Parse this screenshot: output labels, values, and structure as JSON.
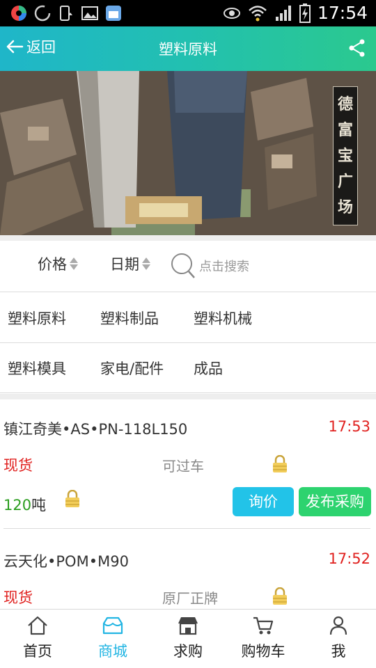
{
  "status_bar": {
    "time": "17:54",
    "icons": [
      "app-icon",
      "loading-icon",
      "phone-sync-icon",
      "image-icon",
      "store-icon",
      "eye-icon",
      "wifi-icon",
      "signal-icon",
      "battery-icon"
    ]
  },
  "header": {
    "back_label": "返回",
    "title": "塑料原料",
    "share_icon": "share-icon"
  },
  "banner": {
    "sign_chars": [
      "德",
      "富",
      "宝",
      "广",
      "场"
    ]
  },
  "sort_bar": {
    "price_label": "价格",
    "date_label": "日期",
    "search_placeholder": "点击搜索"
  },
  "categories": [
    [
      "塑料原料",
      "塑料制品",
      "塑料机械"
    ],
    [
      "塑料模具",
      "家电/配件",
      "成品"
    ]
  ],
  "listings": [
    {
      "name": "镇江奇美•AS•PN-118L150",
      "time": "17:53",
      "stock": "现货",
      "tag": "可过车",
      "quantity": "120",
      "unit": "吨",
      "inquire_label": "询价",
      "publish_label": "发布采购"
    },
    {
      "name": "云天化•POM•M90",
      "time": "17:52",
      "stock": "现货",
      "tag": "原厂正牌"
    }
  ],
  "bottom_nav": [
    {
      "label": "首页",
      "icon": "home-icon",
      "active": false
    },
    {
      "label": "商城",
      "icon": "mall-icon",
      "active": true
    },
    {
      "label": "求购",
      "icon": "shop-icon",
      "active": false
    },
    {
      "label": "购物车",
      "icon": "cart-icon",
      "active": false
    },
    {
      "label": "我",
      "icon": "user-icon",
      "active": false
    }
  ],
  "colors": {
    "header_start": "#1fb6c9",
    "header_end": "#2bc98e",
    "accent_red": "#e0201e",
    "quantity_green": "#2a9d1e",
    "inquire_button": "#22c3e8",
    "publish_button": "#2dd36f",
    "active_nav": "#22b5e3"
  }
}
